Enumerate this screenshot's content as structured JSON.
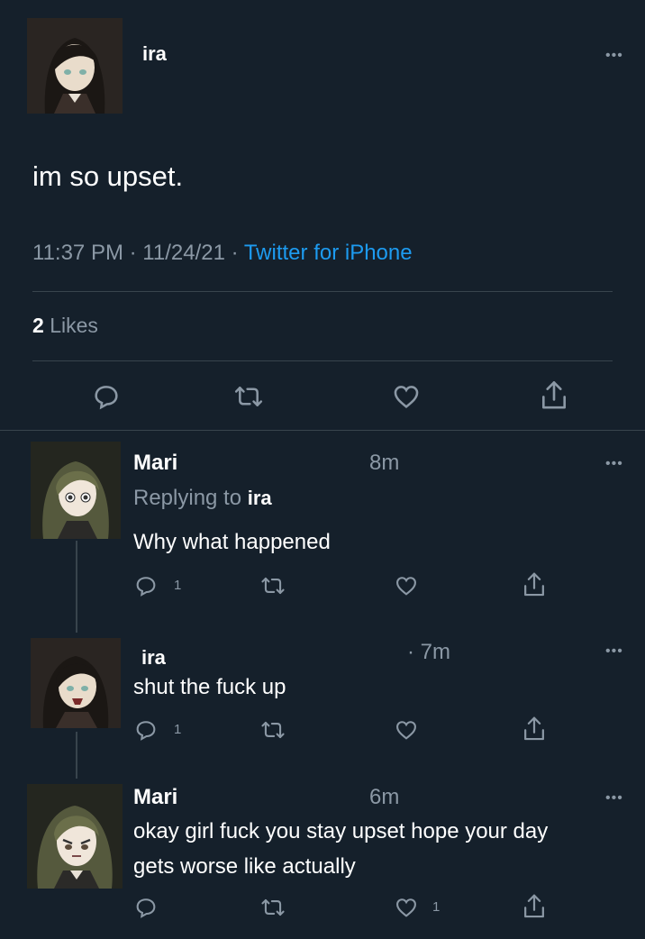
{
  "main_tweet": {
    "author": "ira",
    "text": "im so upset.",
    "time": "11:37 PM",
    "date": "11/24/21",
    "source": "Twitter for iPhone",
    "likes_count": "2",
    "likes_label": "Likes"
  },
  "replies": [
    {
      "author": "Mari",
      "time": "8m",
      "replying_label": "Replying to",
      "replying_to": "ira",
      "text": "Why what happened",
      "reply_count": "1",
      "like_count": ""
    },
    {
      "author": "ira",
      "time": "· 7m",
      "text": "shut the fuck up",
      "reply_count": "1",
      "like_count": ""
    },
    {
      "author": "Mari",
      "time": "6m",
      "text_line1": "okay girl fuck you stay upset hope your day",
      "text_line2": "gets worse like actually",
      "reply_count": "",
      "like_count": "1"
    }
  ],
  "separator": "·",
  "colors": {
    "background": "#15202b",
    "muted": "#8b98a5",
    "link": "#1d9bf0",
    "divider": "#38444d"
  }
}
